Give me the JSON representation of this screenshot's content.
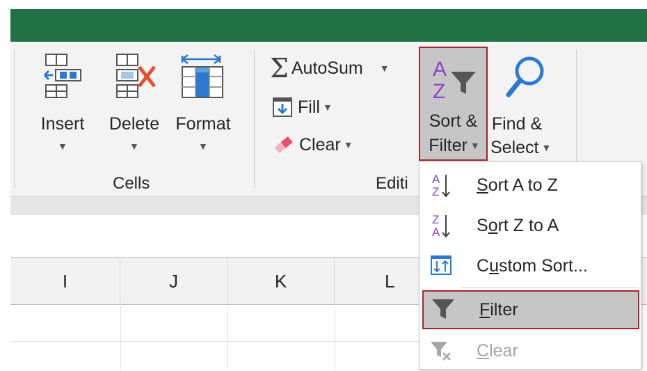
{
  "ribbon": {
    "cells_group": {
      "label": "Cells",
      "insert_label": "Insert",
      "delete_label": "Delete",
      "format_label": "Format"
    },
    "editing_group": {
      "label": "Editi",
      "autosum_label": "AutoSum",
      "fill_label": "Fill",
      "clear_label": "Clear",
      "sort_filter_line1": "Sort &",
      "sort_filter_line2": "Filter",
      "find_select_line1": "Find &",
      "find_select_line2": "Select"
    }
  },
  "columns": [
    "I",
    "J",
    "K",
    "L"
  ],
  "sort_filter_menu": {
    "items": [
      {
        "pre": "",
        "ul": "S",
        "post": "ort A to Z",
        "icon": "sort-a-to-z-icon",
        "disabled": false
      },
      {
        "pre": "S",
        "ul": "o",
        "post": "rt Z to A",
        "icon": "sort-z-to-a-icon",
        "disabled": false
      },
      {
        "pre": "C",
        "ul": "u",
        "post": "stom Sort...",
        "icon": "custom-sort-icon",
        "disabled": false
      },
      {
        "pre": "",
        "ul": "F",
        "post": "ilter",
        "icon": "filter-icon",
        "disabled": false
      },
      {
        "pre": "",
        "ul": "C",
        "post": "lear",
        "icon": "clear-filter-icon",
        "disabled": true
      }
    ]
  },
  "colors": {
    "title_bar": "#217346",
    "highlight_border": "#a4262c",
    "highlight_fill": "#c6c6c6",
    "sort_icon_purple": "#8e44c4",
    "icon_blue": "#2b79d0",
    "delete_red": "#e0522c"
  }
}
